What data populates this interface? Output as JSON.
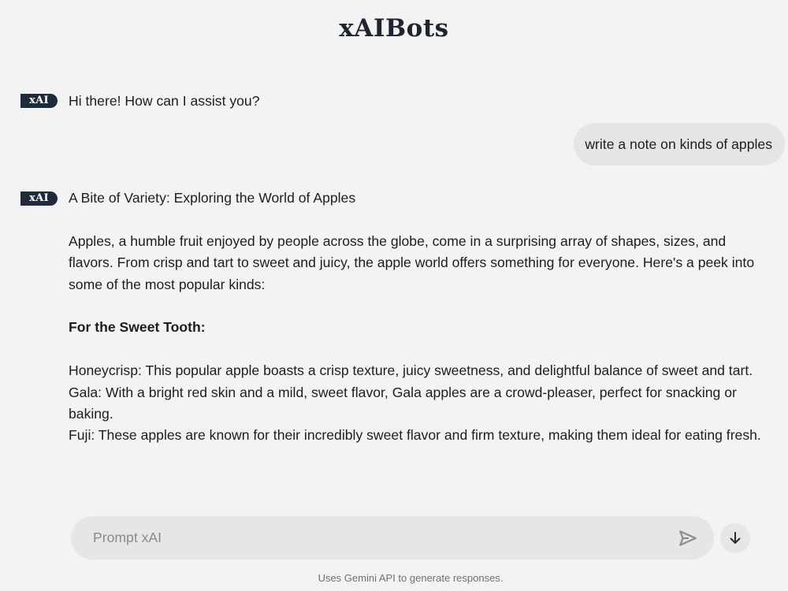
{
  "app": {
    "title": "xAIBots"
  },
  "messages": {
    "bot_badge": "xAI",
    "greeting": "Hi there! How can I assist you?",
    "user_message": "write a note on kinds of apples",
    "response": {
      "title": "A Bite of Variety: Exploring the World of Apples",
      "intro": "Apples, a humble fruit enjoyed by people across the globe, come in a surprising array of shapes, sizes, and flavors. From crisp and tart to sweet and juicy, the apple world offers something for everyone. Here's a peek into some of the most popular kinds:",
      "section_heading": "For the Sweet Tooth:",
      "items": [
        "Honeycrisp: This popular apple boasts a crisp texture, juicy sweetness, and delightful balance of sweet and tart.",
        "Gala: With a bright red skin and a mild, sweet flavor, Gala apples are a crowd-pleaser, perfect for snacking or baking.",
        "Fuji: These apples are known for their incredibly sweet flavor and firm texture, making them ideal for eating fresh."
      ]
    }
  },
  "prompt": {
    "placeholder": "Prompt xAI",
    "value": "",
    "send_icon": "send-icon",
    "scroll_icon": "arrow-down-icon"
  },
  "footer": {
    "text": "Uses Gemini API to generate responses."
  },
  "colors": {
    "background": "#f3f3f3",
    "badge": "#1f2a3a",
    "bubble": "#e5e5e5",
    "input": "#e6e6e6"
  }
}
